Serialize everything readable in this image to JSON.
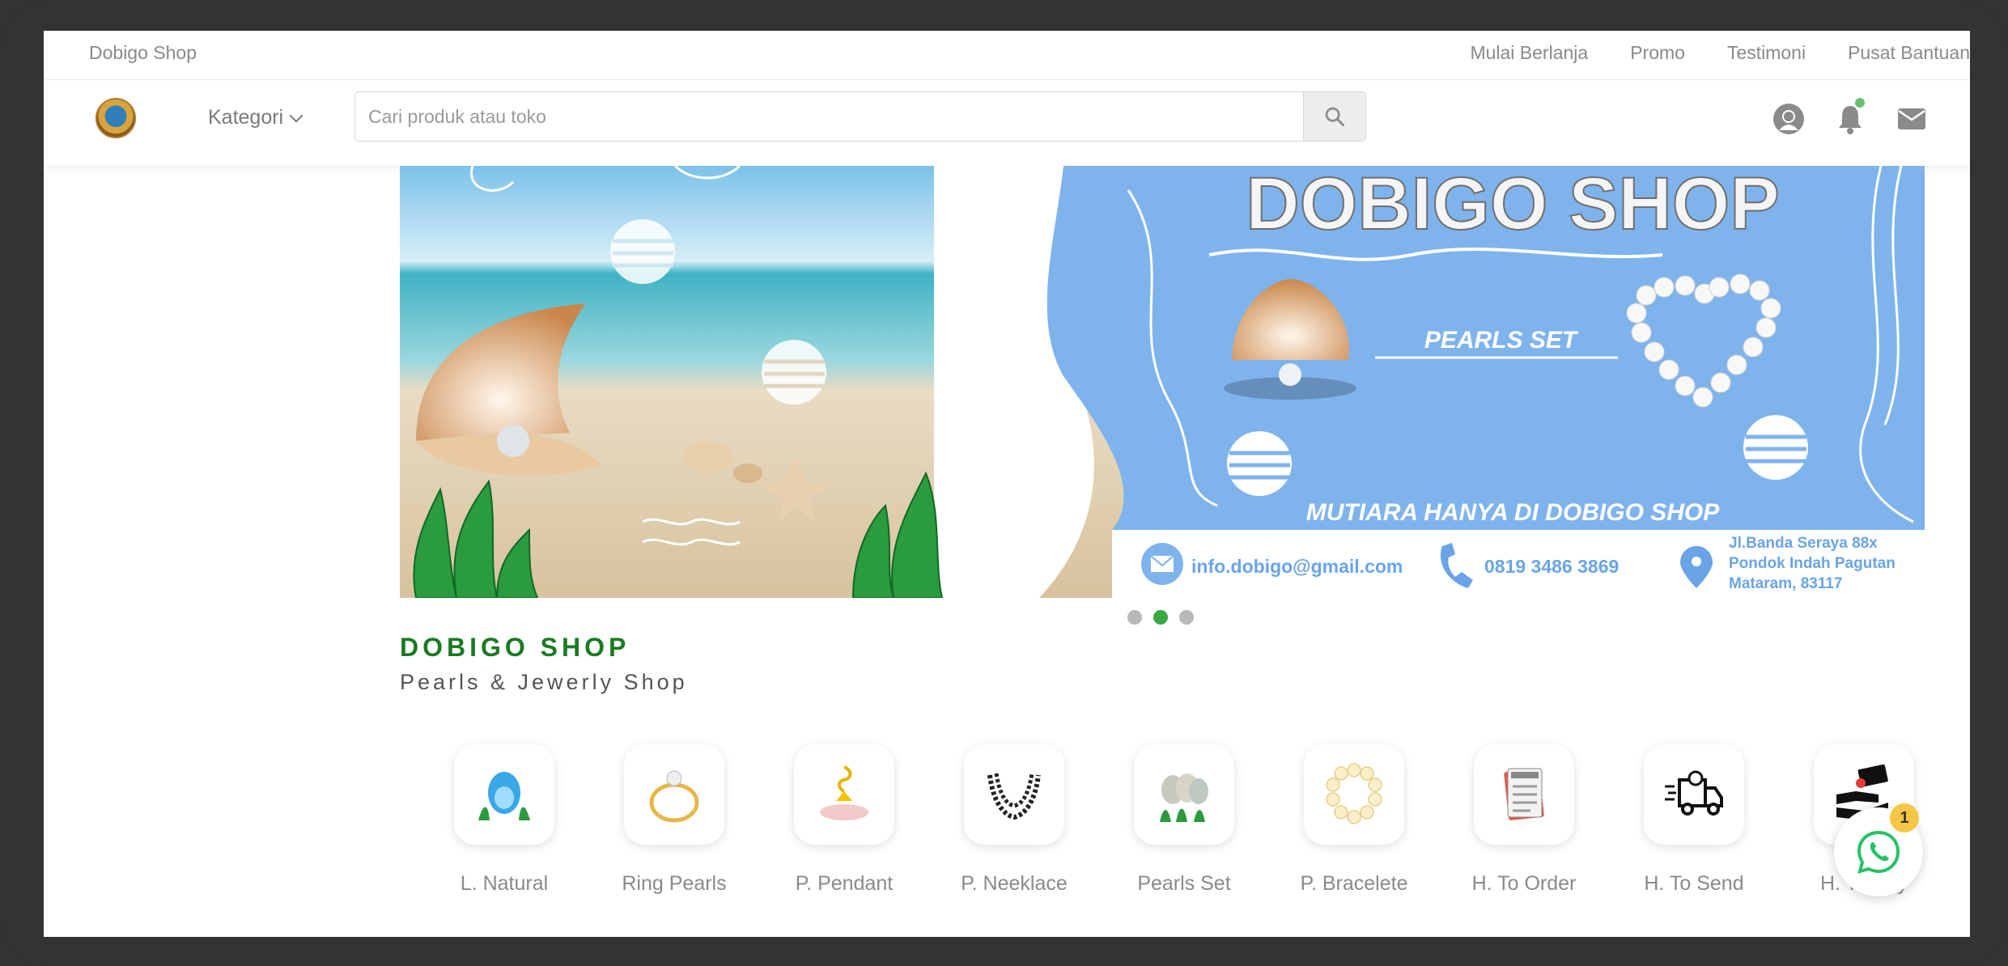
{
  "topbar": {
    "brand": "Dobigo Shop",
    "links": [
      "Mulai Berlanja",
      "Promo",
      "Testimoni",
      "Pusat Bantuan"
    ]
  },
  "header": {
    "kategori_label": "Kategori",
    "search_placeholder": "Cari produk atau toko",
    "icons": [
      "user-icon",
      "bell-icon",
      "mail-icon"
    ]
  },
  "banner": {
    "title": "DOBIGO SHOP",
    "subtitle": "PEARLS SET",
    "tagline": "MUTIARA HANYA DI DOBIGO SHOP",
    "email": "info.dobigo@gmail.com",
    "phone": "0819 3486 3869",
    "address_line1": "Jl.Banda Seraya 88x",
    "address_line2": "Pondok Indah Pagutan",
    "address_line3": "Mataram, 83117",
    "slides": 3,
    "active_slide": 2
  },
  "shop": {
    "name": "DOBIGO SHOP",
    "tagline": "Pearls & Jewerly Shop"
  },
  "categories": [
    {
      "label": "L. Natural",
      "icon": "natural-pearl-icon"
    },
    {
      "label": "Ring Pearls",
      "icon": "ring-icon"
    },
    {
      "label": "P. Pendant",
      "icon": "pendant-icon"
    },
    {
      "label": "P. Neeklace",
      "icon": "necklace-icon"
    },
    {
      "label": "Pearls Set",
      "icon": "pearls-set-icon"
    },
    {
      "label": "P. Bracelete",
      "icon": "bracelet-icon"
    },
    {
      "label": "H. To Order",
      "icon": "order-icon"
    },
    {
      "label": "H. To Send",
      "icon": "delivery-truck-icon"
    },
    {
      "label": "H. To Pay",
      "icon": "payment-icon"
    }
  ],
  "whatsapp": {
    "badge": "1"
  },
  "colors": {
    "accent_green": "#1b7a24",
    "banner_blue": "#7fb3ec"
  }
}
